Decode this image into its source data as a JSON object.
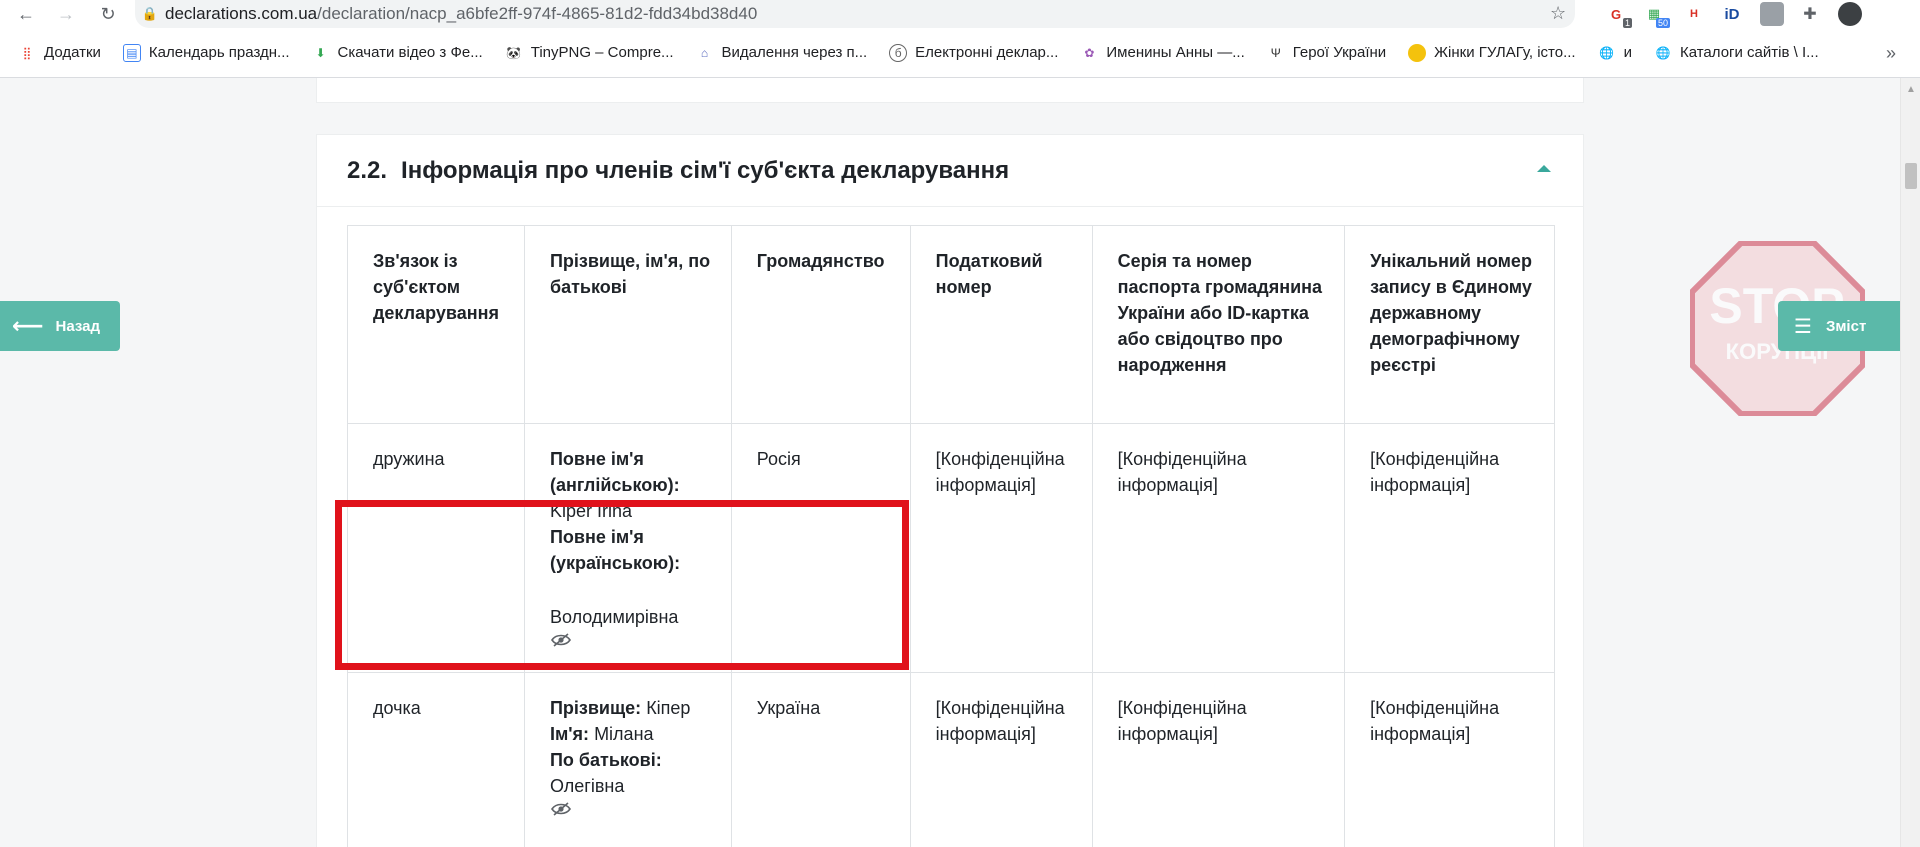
{
  "browser": {
    "url_host": "declarations.com.ua",
    "url_path": "/declaration/nacp_a6bfe2ff-974f-4865-81d2-fdd34bd38d40",
    "extensions": [
      {
        "name": "grammar-extension",
        "badge": "1"
      },
      {
        "name": "speed-extension",
        "badge": "50"
      },
      {
        "name": "tag-extension",
        "label": "H"
      },
      {
        "name": "id-extension",
        "label": "iD"
      },
      {
        "name": "picture-extension",
        "label": ""
      },
      {
        "name": "puzzle-extension",
        "label": ""
      },
      {
        "name": "profile-avatar",
        "label": ""
      }
    ]
  },
  "bookmarks": [
    {
      "label": "Додатки",
      "icon": "apps-grid-icon",
      "color": "#ea4335"
    },
    {
      "label": "Календарь праздн...",
      "icon": "calendar-icon",
      "color": "#4285f4"
    },
    {
      "label": "Скачати відео з Фе...",
      "icon": "download-arrow-icon",
      "color": "#34a853"
    },
    {
      "label": "TinyPNG – Compre...",
      "icon": "panda-icon",
      "color": "#333333"
    },
    {
      "label": "Видалення через п...",
      "icon": "house-icon",
      "color": "#5b6bbf"
    },
    {
      "label": "Електронні деклар...",
      "icon": "declaration-icon",
      "color": "#666666"
    },
    {
      "label": "Именины Анны —...",
      "icon": "flower-icon",
      "color": "#9b59b6"
    },
    {
      "label": "Герої України",
      "icon": "trident-icon",
      "color": "#333333"
    },
    {
      "label": "Жінки ГУЛАГу, істо...",
      "icon": "circle-icon",
      "color": "#f4c20d"
    },
    {
      "label": "и",
      "icon": "globe-icon",
      "color": "#5f6368"
    },
    {
      "label": "Каталоги сайтів \\ І...",
      "icon": "globe-icon",
      "color": "#5f6368"
    }
  ],
  "bookmarks_more": "»",
  "nav": {
    "back_label": "Назад",
    "toc_label": "Зміст"
  },
  "stamp": {
    "line1": "STOP",
    "line2": "КОРУПЦІЇ",
    "color": "#c9354b"
  },
  "section": {
    "number": "2.2.",
    "title": "Інформація про членів сім'ї суб'єкта декларування"
  },
  "table": {
    "headers": [
      "Зв'язок із суб'єктом декларування",
      "Прізвище, ім'я, по батькові",
      "Громадянство",
      "Податковий номер",
      "Серія та номер паспорта громадянина України або ID-картка або свідоцтво про народження",
      "Унікальний номер запису в Єдиному державному демографічному реєстрі"
    ],
    "rows": [
      {
        "relation": "дружина",
        "name_en_label": "Повне ім'я (англійською):",
        "name_en": "Kiper Irina",
        "name_ua_label": "Повне ім'я (українською):",
        "name_ua": "Володимирівна",
        "citizenship": "Росія",
        "tax_id": "[Конфіденційна інформація]",
        "passport": "[Конфіденційна інформація]",
        "registry_id": "[Конфіденційна інформація]"
      },
      {
        "relation": "дочка",
        "surname_label": "Прізвище:",
        "surname": "Кіпер",
        "first_name_label": "Ім'я:",
        "first_name": "Мілана",
        "patronymic_label": "По батькові:",
        "patronymic": "Олегівна",
        "citizenship": "Україна",
        "tax_id": "[Конфіденційна інформація]",
        "passport": "[Конфіденційна інформація]",
        "registry_id": "[Конфіденційна інформація]"
      }
    ]
  },
  "colors": {
    "accent": "#5bb9a9",
    "highlight": "#e0121b"
  }
}
